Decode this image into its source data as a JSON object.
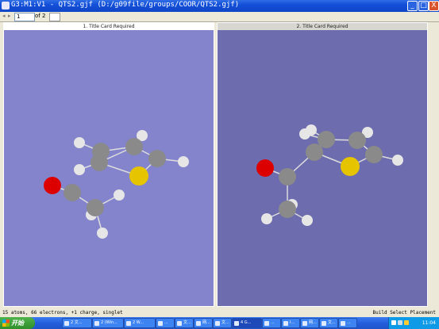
{
  "window": {
    "title": "G3:M1:V1 - QTS2.gjf (D:/g09file/groups/COOR/QTS2.gjf)",
    "buttons": {
      "minimize": "_",
      "maximize": "□",
      "close": "X"
    }
  },
  "toolbar": {
    "page_value": "1",
    "page_of": "of 2"
  },
  "panels": [
    {
      "caption": "1.  Title Card Required",
      "background": "#8484cc"
    },
    {
      "caption": "2.  Title Card Required",
      "background": "#6c6cae"
    }
  ],
  "status": {
    "left": "15 atoms, 66 electrons, +1 charge, singlet",
    "right": "Build Select Placement"
  },
  "taskbar": {
    "start_label": "开始",
    "tasks": [
      "2 文...",
      "2 (Win...",
      "2 W...",
      "...",
      "文...",
      "网...",
      "文...",
      "4 G...",
      "...",
      "I...",
      "网...",
      "文...",
      "..."
    ],
    "clock": "11:04"
  },
  "colors": {
    "carbon": "#8a8a8a",
    "hydrogen": "#e6e6e6",
    "oxygen": "#dd0000",
    "sulfur": "#e6c400"
  }
}
